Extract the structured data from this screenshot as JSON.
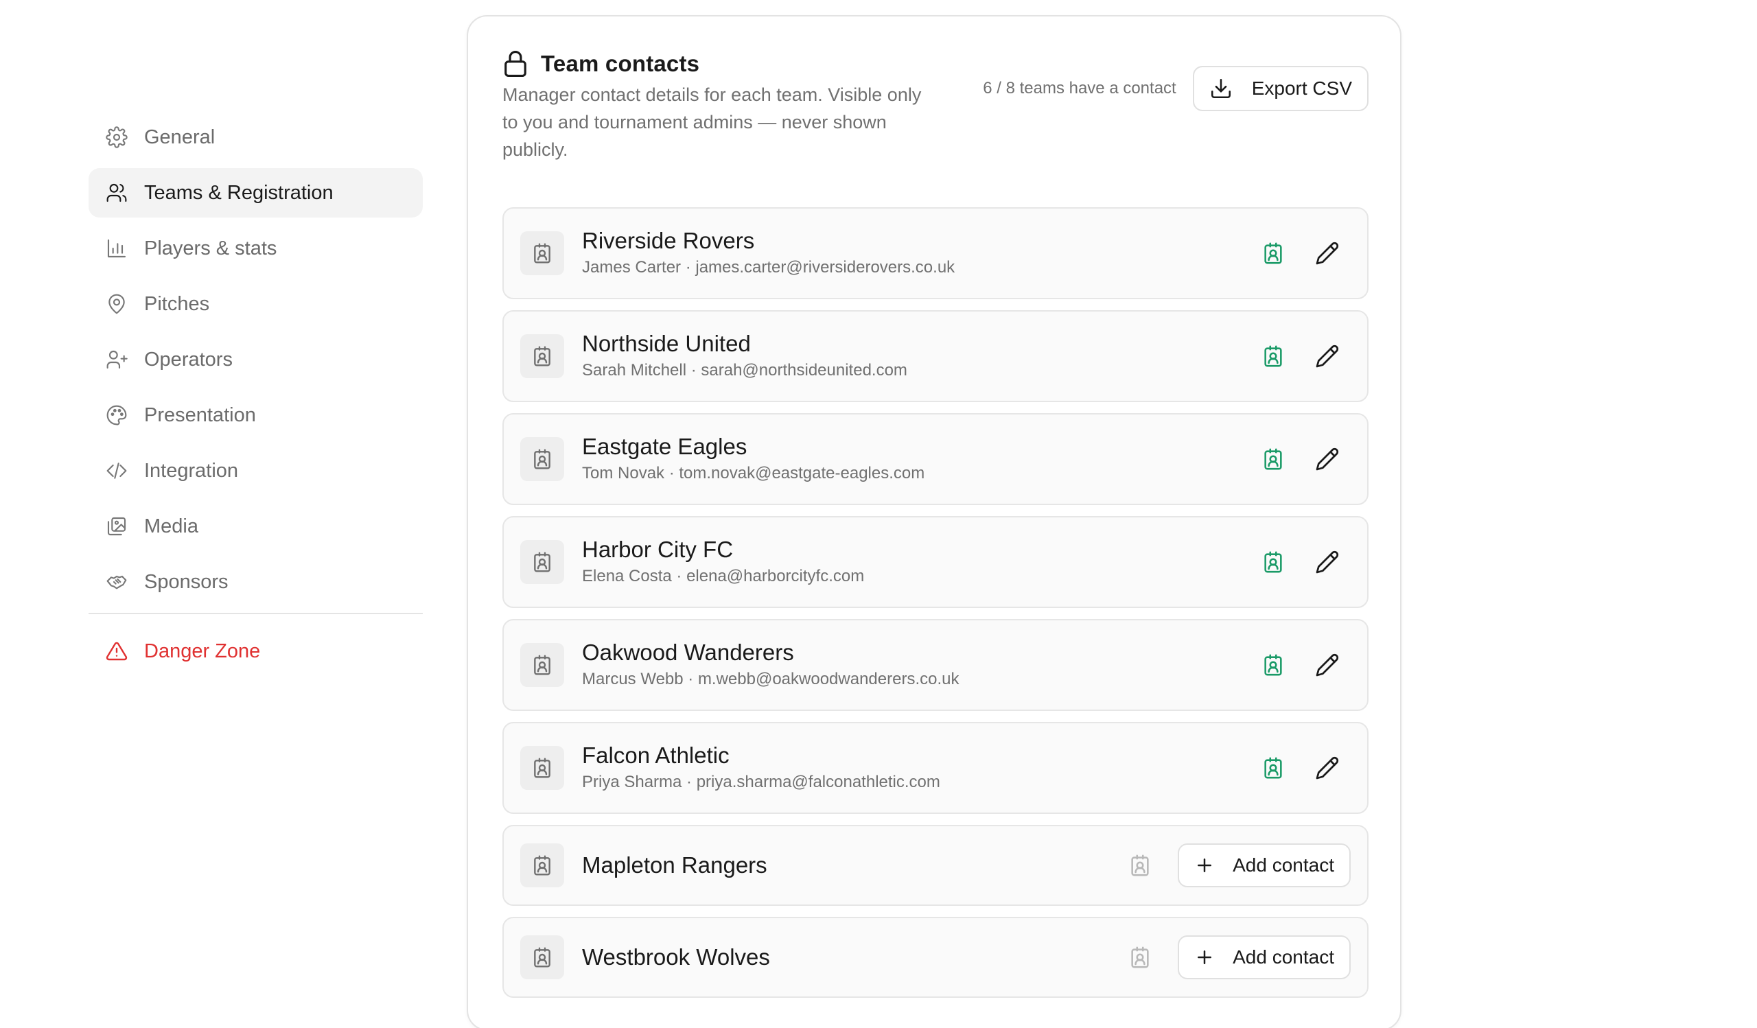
{
  "sidebar": {
    "items": [
      {
        "label": "General",
        "icon": "gear-icon"
      },
      {
        "label": "Teams & Registration",
        "icon": "users-icon",
        "active": true
      },
      {
        "label": "Players & stats",
        "icon": "bar-chart-icon"
      },
      {
        "label": "Pitches",
        "icon": "map-pin-icon"
      },
      {
        "label": "Operators",
        "icon": "user-plus-icon"
      },
      {
        "label": "Presentation",
        "icon": "palette-icon"
      },
      {
        "label": "Integration",
        "icon": "code-icon"
      },
      {
        "label": "Media",
        "icon": "images-icon"
      },
      {
        "label": "Sponsors",
        "icon": "handshake-icon"
      }
    ],
    "danger": {
      "label": "Danger Zone",
      "icon": "warning-triangle-icon"
    }
  },
  "card": {
    "title": "Team contacts",
    "description": "Manager contact details for each team. Visible only to you and tournament admins — never shown publicly.",
    "count_text": "6 / 8 teams have a contact",
    "export_label": "Export CSV"
  },
  "teams": [
    {
      "name": "Riverside Rovers",
      "contact": "James Carter · james.carter@riversiderovers.co.uk",
      "has_contact": true
    },
    {
      "name": "Northside United",
      "contact": "Sarah Mitchell · sarah@northsideunited.com",
      "has_contact": true
    },
    {
      "name": "Eastgate Eagles",
      "contact": "Tom Novak · tom.novak@eastgate-eagles.com",
      "has_contact": true
    },
    {
      "name": "Harbor City FC",
      "contact": "Elena Costa · elena@harborcityfc.com",
      "has_contact": true
    },
    {
      "name": "Oakwood Wanderers",
      "contact": "Marcus Webb · m.webb@oakwoodwanderers.co.uk",
      "has_contact": true
    },
    {
      "name": "Falcon Athletic",
      "contact": "Priya Sharma · priya.sharma@falconathletic.com",
      "has_contact": true
    },
    {
      "name": "Mapleton Rangers",
      "has_contact": false,
      "action_label": "Add contact"
    },
    {
      "name": "Westbrook Wolves",
      "has_contact": false,
      "action_label": "Add contact"
    }
  ],
  "colors": {
    "accent_green": "#1a9a67",
    "danger": "#e03131",
    "active_bg": "#f3f3f3"
  }
}
